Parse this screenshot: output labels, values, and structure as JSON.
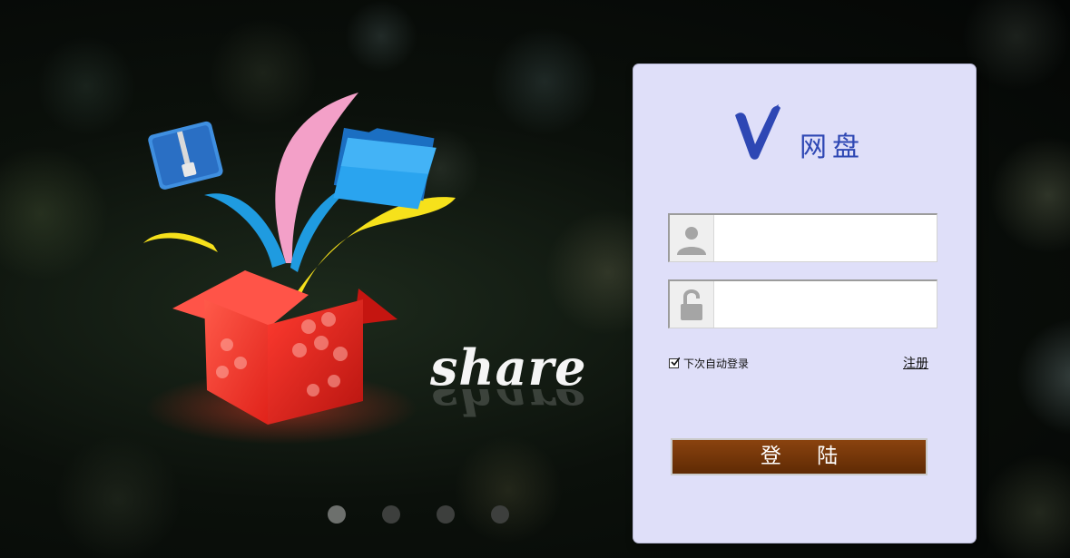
{
  "brand": {
    "name": "网盘",
    "logo_letter": "V",
    "accent": "#2e47b4"
  },
  "hero": {
    "word": "share",
    "carousel": {
      "count": 4,
      "active": 1
    }
  },
  "login": {
    "username_placeholder": "",
    "password_placeholder": "",
    "remember_label": "下次自动登录",
    "remember_checked": true,
    "register_label": "注册",
    "submit_label": "登 陆",
    "button_color": "#6e3308",
    "panel_color": "#dfdff9"
  }
}
